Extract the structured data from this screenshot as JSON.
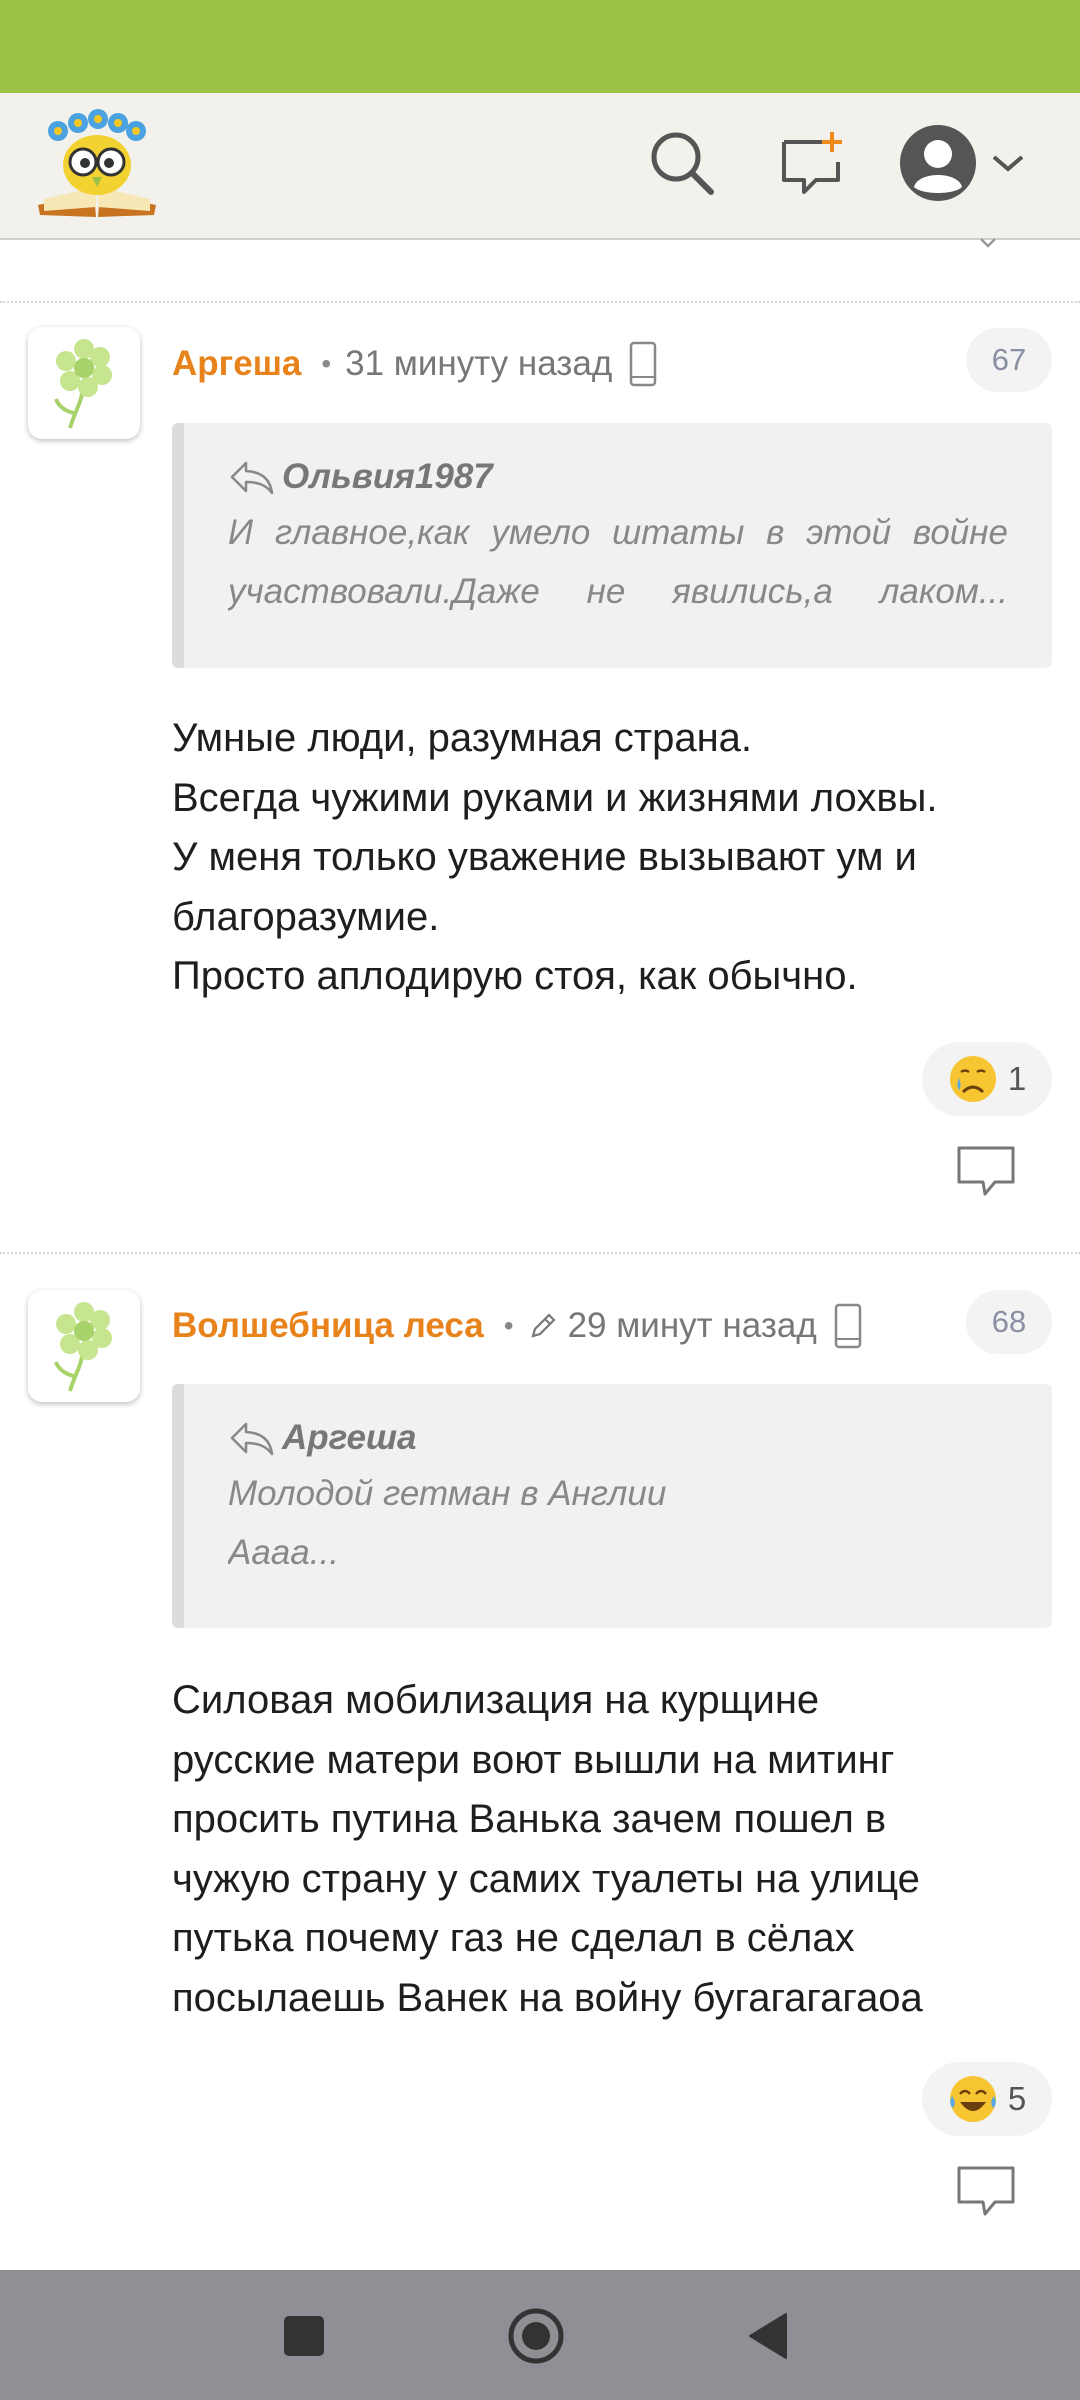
{
  "header": {
    "logo_icon": "owl-book-logo",
    "search_icon": "search-icon",
    "new_message_icon": "new-comment-icon",
    "profile_icon": "user-avatar-icon"
  },
  "comments": [
    {
      "author": "Аргеша",
      "separator": "•",
      "time": "31 минуту назад",
      "edited": false,
      "device_icon": "mobile-phone-icon",
      "number": "67",
      "quote": {
        "author": "Ольвия1987",
        "lines": [
          "И главное,как умело штаты в этой войне",
          "участвовали.Даже не явились,а лаком..."
        ]
      },
      "text_lines": [
        "Умные люди, разумная страна.",
        "Всегда чужими руками и жизнями лохвы.",
        "У меня только уважение вызывают ум и",
        "благоразумие.",
        "Просто аплодирую стоя, как обычно."
      ],
      "reaction": {
        "emoji": "crying-face-emoji",
        "count": "1"
      }
    },
    {
      "author": "Волшебница леса",
      "separator": "•",
      "time": "29 минут назад",
      "edited": true,
      "device_icon": "mobile-phone-icon",
      "number": "68",
      "quote": {
        "author": "Аргеша",
        "lines": [
          "Молодой гетман в Англии",
          "Аааа..."
        ]
      },
      "text_lines": [
        "Силовая мобилизация на курщине",
        "русские матери воют вышли на митинг",
        "просить путина Ванька зачем пошел в",
        "чужую страну у самих туалеты на улице",
        "путька почему газ не сделал в сёлах",
        "посылаешь Ванек на войну бугагагагаоа"
      ],
      "reaction": {
        "emoji": "tears-of-joy-emoji",
        "count": "5"
      }
    }
  ],
  "colors": {
    "status_bar": "#9bc145",
    "app_bar": "#f2f1ec",
    "author": "#e8821b",
    "nav_bar": "#8f8f95"
  },
  "navigation": {
    "recents_icon": "square-recents-icon",
    "home_icon": "circle-home-icon",
    "back_icon": "triangle-back-icon"
  }
}
